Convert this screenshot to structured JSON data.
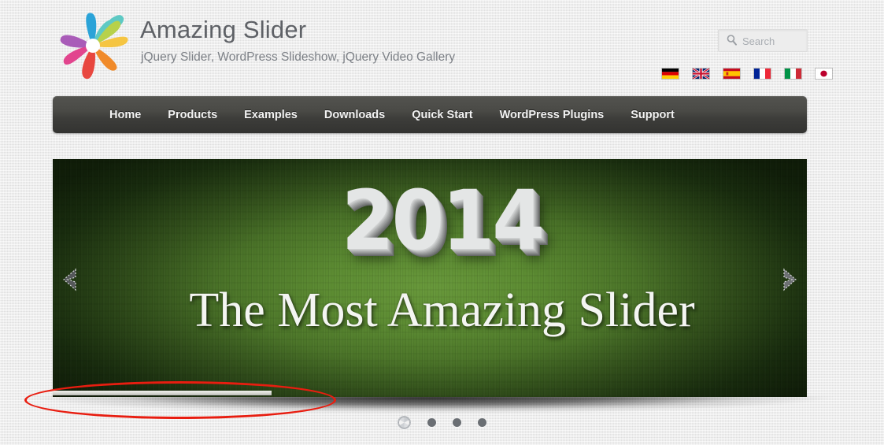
{
  "header": {
    "logo_icon": "flower-pinwheel-logo",
    "logo_petal_colors": [
      "#2aa3d8",
      "#5ec9c4",
      "#b7d14a",
      "#f5c542",
      "#f08a2a",
      "#e8473f",
      "#e2458e",
      "#a95cb8"
    ],
    "title": "Amazing Slider",
    "subtitle": "jQuery Slider, WordPress Slideshow, jQuery Video Gallery",
    "search": {
      "icon": "search-icon",
      "placeholder": "Search",
      "value": ""
    },
    "flags": [
      {
        "name": "flag-germany",
        "label": "Deutsch"
      },
      {
        "name": "flag-united-kingdom",
        "label": "English"
      },
      {
        "name": "flag-spain",
        "label": "Espanol"
      },
      {
        "name": "flag-france",
        "label": "Francais"
      },
      {
        "name": "flag-italy",
        "label": "Italiano"
      },
      {
        "name": "flag-japan",
        "label": "Japanese"
      }
    ]
  },
  "nav": {
    "items": [
      {
        "label": "Home"
      },
      {
        "label": "Products"
      },
      {
        "label": "Examples"
      },
      {
        "label": "Downloads"
      },
      {
        "label": "Quick Start"
      },
      {
        "label": "WordPress Plugins"
      },
      {
        "label": "Support"
      }
    ]
  },
  "slider": {
    "year": "2014",
    "tagline": "The Most Amazing Slider",
    "prev_icon": "chevron-left-icon",
    "next_icon": "chevron-right-icon",
    "progress_percent": 29,
    "bullets": [
      {
        "active": true
      },
      {
        "active": false
      },
      {
        "active": false
      },
      {
        "active": false
      }
    ],
    "background_color": "#5c8b32"
  },
  "annotation": {
    "shape": "ellipse",
    "color": "#e81d10",
    "target": "slider-progress-bar"
  }
}
